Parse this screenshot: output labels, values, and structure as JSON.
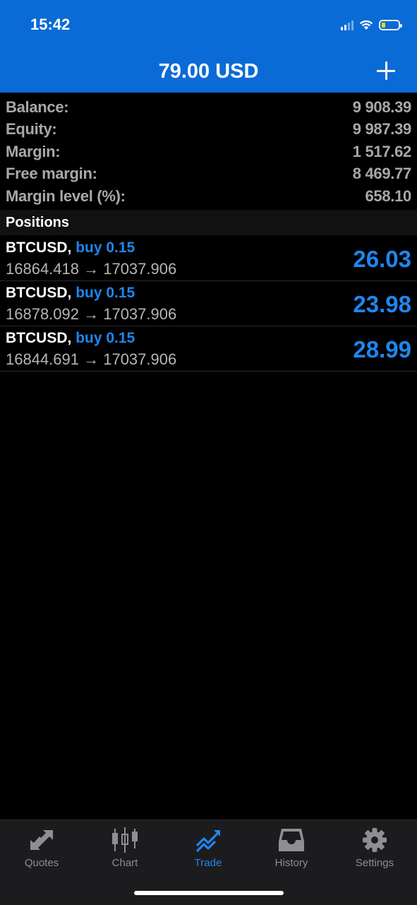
{
  "status": {
    "time": "15:42"
  },
  "header": {
    "title": "79.00 USD"
  },
  "summary": [
    {
      "label": "Balance:",
      "value": "9 908.39"
    },
    {
      "label": "Equity:",
      "value": "9 987.39"
    },
    {
      "label": "Margin:",
      "value": "1 517.62"
    },
    {
      "label": "Free margin:",
      "value": "8 469.77"
    },
    {
      "label": "Margin level (%):",
      "value": "658.10"
    }
  ],
  "positions_header": "Positions",
  "positions": [
    {
      "symbol": "BTCUSD,",
      "direction": "buy 0.15",
      "prices": "16864.418 → 17037.906",
      "profit": "26.03"
    },
    {
      "symbol": "BTCUSD,",
      "direction": "buy 0.15",
      "prices": "16878.092 → 17037.906",
      "profit": "23.98"
    },
    {
      "symbol": "BTCUSD,",
      "direction": "buy 0.15",
      "prices": "16844.691 → 17037.906",
      "profit": "28.99"
    }
  ],
  "tabs": [
    {
      "label": "Quotes",
      "icon": "quotes-arrows-icon"
    },
    {
      "label": "Chart",
      "icon": "candlestick-icon"
    },
    {
      "label": "Trade",
      "icon": "trend-up-icon",
      "active": true
    },
    {
      "label": "History",
      "icon": "inbox-tray-icon"
    },
    {
      "label": "Settings",
      "icon": "gear-icon"
    }
  ],
  "colors": {
    "header_bg": "#0a6bd6",
    "accent": "#1e86f0",
    "muted": "#8e8e93"
  }
}
